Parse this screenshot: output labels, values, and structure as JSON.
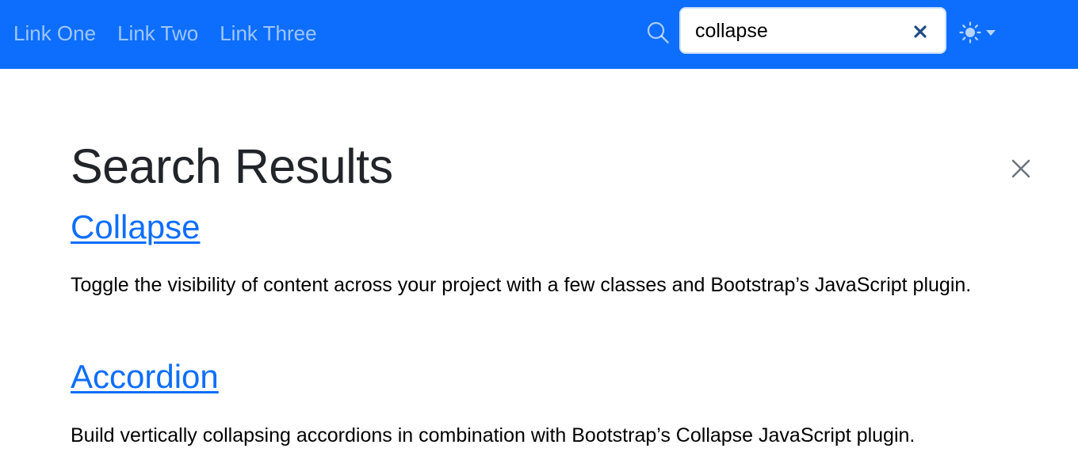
{
  "navbar": {
    "links": [
      "Link One",
      "Link Two",
      "Link Three"
    ],
    "search": {
      "value": "collapse",
      "icon": "search-icon",
      "clear_icon": "close-icon"
    },
    "theme_toggle": {
      "icon": "sun-icon",
      "caret_icon": "caret-down-icon"
    },
    "background_color": "#0d6efd"
  },
  "main": {
    "title": "Search Results",
    "close_icon": "close-icon",
    "results": [
      {
        "title": "Collapse",
        "description": "Toggle the visibility of content across your project with a few classes and Bootstrap’s JavaScript plugin."
      },
      {
        "title": "Accordion",
        "description": "Build vertically collapsing accordions in combination with Bootstrap’s Collapse JavaScript plugin."
      }
    ],
    "link_color": "#0d6efd"
  }
}
